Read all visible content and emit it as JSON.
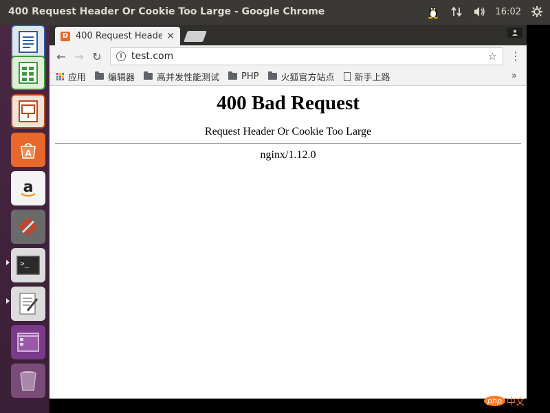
{
  "window": {
    "title": "400 Request Header Or Cookie Too Large - Google Chrome",
    "clock": "16:02"
  },
  "launcher": {
    "items": [
      {
        "name": "writer-icon",
        "color": "#2a5aa8"
      },
      {
        "name": "calc-icon",
        "color": "#3d9a3d"
      },
      {
        "name": "impress-icon",
        "color": "#b74a1e"
      },
      {
        "name": "software-center-icon",
        "color": "#e8672b"
      },
      {
        "name": "amazon-icon",
        "color": "#f0f0f0"
      },
      {
        "name": "system-settings-icon",
        "color": "#c8412e"
      },
      {
        "name": "terminal-icon",
        "color": "#2a2a2a"
      },
      {
        "name": "text-editor-icon",
        "color": "#e6e6e6"
      },
      {
        "name": "workspace-switcher-icon",
        "color": "#7b3a8a"
      },
      {
        "name": "trash-icon",
        "color": "#8a5a8a"
      }
    ]
  },
  "tab": {
    "title": "400 Request Heade",
    "favicon": "D"
  },
  "omnibox": {
    "url": "test.com"
  },
  "bookmarks": {
    "apps_label": "应用",
    "items": [
      "编辑器",
      "高并发性能测试",
      "PHP",
      "火狐官方站点"
    ],
    "page_item": "新手上路",
    "more": "»"
  },
  "content": {
    "heading": "400 Bad Request",
    "message": "Request Header Or Cookie Too Large",
    "server": "nginx/1.12.0"
  },
  "watermark": {
    "logo": "php",
    "text": "中文"
  }
}
